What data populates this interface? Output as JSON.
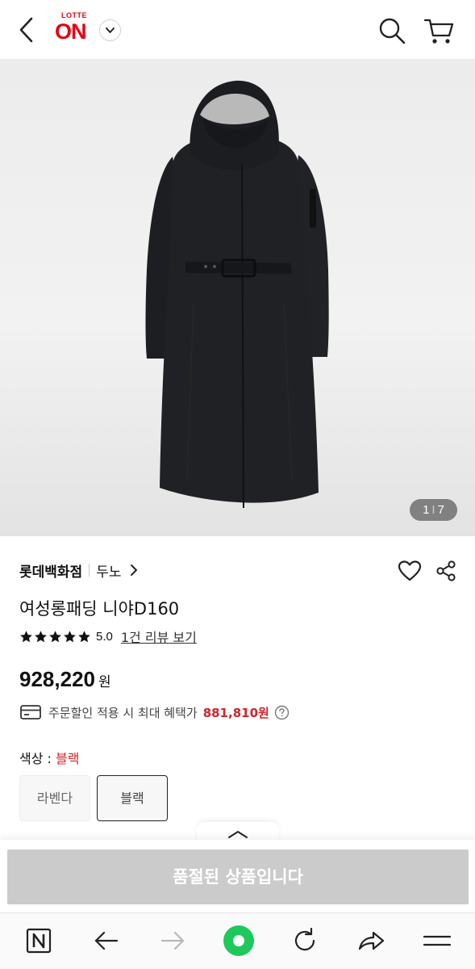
{
  "header": {
    "logo_top": "LOTTE",
    "logo_main": "ON"
  },
  "gallery": {
    "current": "1",
    "separator": "I",
    "total": "7"
  },
  "product": {
    "brand": "롯데백화점",
    "sub_brand": "두노",
    "title": "여성롱패딩 니야D160",
    "rating_stars": 5,
    "rating_score": "5.0",
    "review_link": "1건 리뷰 보기",
    "price": "928,220",
    "price_unit": "원",
    "benefit_text": "주문할인 적용 시 최대 혜택가",
    "benefit_price": "881,810원",
    "color_label": "색상 : ",
    "color_value": "블랙",
    "options": [
      "라벤다",
      "블랙"
    ]
  },
  "action": {
    "soldout_label": "품절된 상품입니다"
  },
  "colors": {
    "brand_red": "#e60012",
    "accent_red": "#d0242b",
    "disabled_gray": "#cbcbcb",
    "browser_green": "#1ec85a"
  },
  "icons": [
    "back-icon",
    "chevron-down-icon",
    "search-icon",
    "cart-icon",
    "heart-icon",
    "share-icon",
    "star-icon",
    "card-icon",
    "help-icon",
    "chevron-up-icon",
    "naver-n-icon",
    "arrow-left-icon",
    "arrow-right-icon",
    "home-dot-icon",
    "refresh-icon",
    "share-arrow-icon",
    "menu-icon"
  ]
}
